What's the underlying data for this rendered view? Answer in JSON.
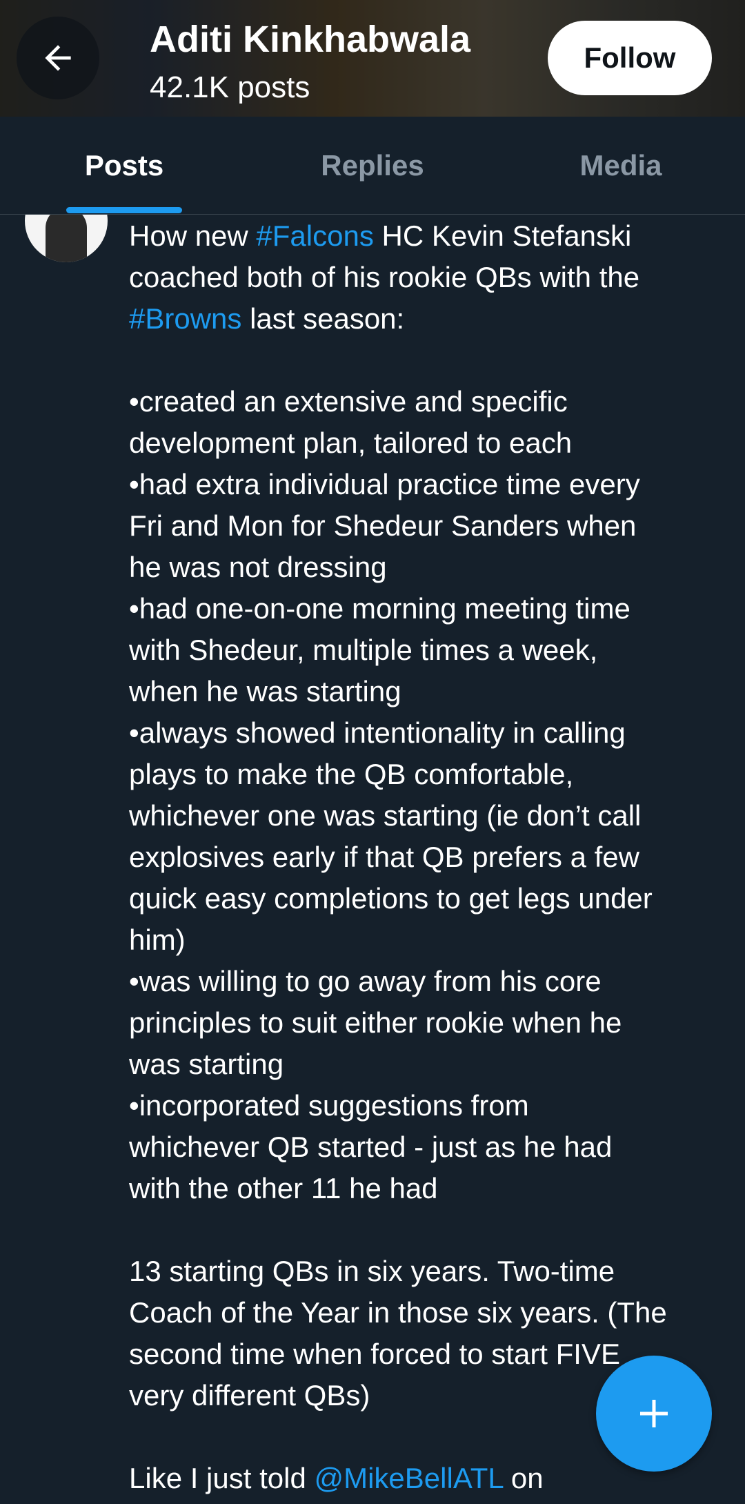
{
  "header": {
    "name": "Aditi Kinkhabwala",
    "posts_count": "42.1K posts",
    "follow_label": "Follow"
  },
  "tabs": [
    {
      "label": "Posts",
      "active": true
    },
    {
      "label": "Replies",
      "active": false
    },
    {
      "label": "Media",
      "active": false
    }
  ],
  "post": {
    "lines": [
      [
        {
          "t": "How new "
        },
        {
          "t": "#Falcons",
          "link": true
        },
        {
          "t": " HC Kevin Stefanski"
        }
      ],
      [
        {
          "t": "coached both of his rookie QBs with the"
        }
      ],
      [
        {
          "t": "#Browns",
          "link": true
        },
        {
          "t": " last season:"
        }
      ],
      [
        {
          "t": ""
        }
      ],
      [
        {
          "t": "•created an extensive and specific"
        }
      ],
      [
        {
          "t": "development plan, tailored to each"
        }
      ],
      [
        {
          "t": "•had extra individual practice time every"
        }
      ],
      [
        {
          "t": "Fri and Mon for Shedeur Sanders when"
        }
      ],
      [
        {
          "t": "he was not dressing"
        }
      ],
      [
        {
          "t": "•had one-on-one morning meeting time"
        }
      ],
      [
        {
          "t": "with Shedeur, multiple times a week,"
        }
      ],
      [
        {
          "t": "when he was starting"
        }
      ],
      [
        {
          "t": "•always showed intentionality in calling"
        }
      ],
      [
        {
          "t": "plays to make the QB comfortable,"
        }
      ],
      [
        {
          "t": "whichever one was starting (ie don’t call"
        }
      ],
      [
        {
          "t": "explosives early if that QB prefers a few"
        }
      ],
      [
        {
          "t": "quick easy completions to get legs under"
        }
      ],
      [
        {
          "t": "him)"
        }
      ],
      [
        {
          "t": "•was willing to go away from his core"
        }
      ],
      [
        {
          "t": "principles to suit either rookie when he"
        }
      ],
      [
        {
          "t": "was starting"
        }
      ],
      [
        {
          "t": "•incorporated suggestions from"
        }
      ],
      [
        {
          "t": "whichever QB started - just as he had"
        }
      ],
      [
        {
          "t": "with the other 11 he had"
        }
      ],
      [
        {
          "t": ""
        }
      ],
      [
        {
          "t": "13 starting QBs in six years. Two-time"
        }
      ],
      [
        {
          "t": "Coach of the Year in those six years. (The"
        }
      ],
      [
        {
          "t": "second time when forced to start FIVE"
        }
      ],
      [
        {
          "t": "very different QBs)"
        }
      ],
      [
        {
          "t": ""
        }
      ],
      [
        {
          "t": "Like I just told "
        },
        {
          "t": "@MikeBellATL",
          "link": true
        },
        {
          "t": " on"
        }
      ]
    ]
  },
  "icons": {
    "back": "arrow-left-icon",
    "compose": "plus-icon"
  },
  "colors": {
    "background": "#15202b",
    "accent": "#1d9bf0",
    "muted": "#8b98a5",
    "divider": "#38444d"
  }
}
